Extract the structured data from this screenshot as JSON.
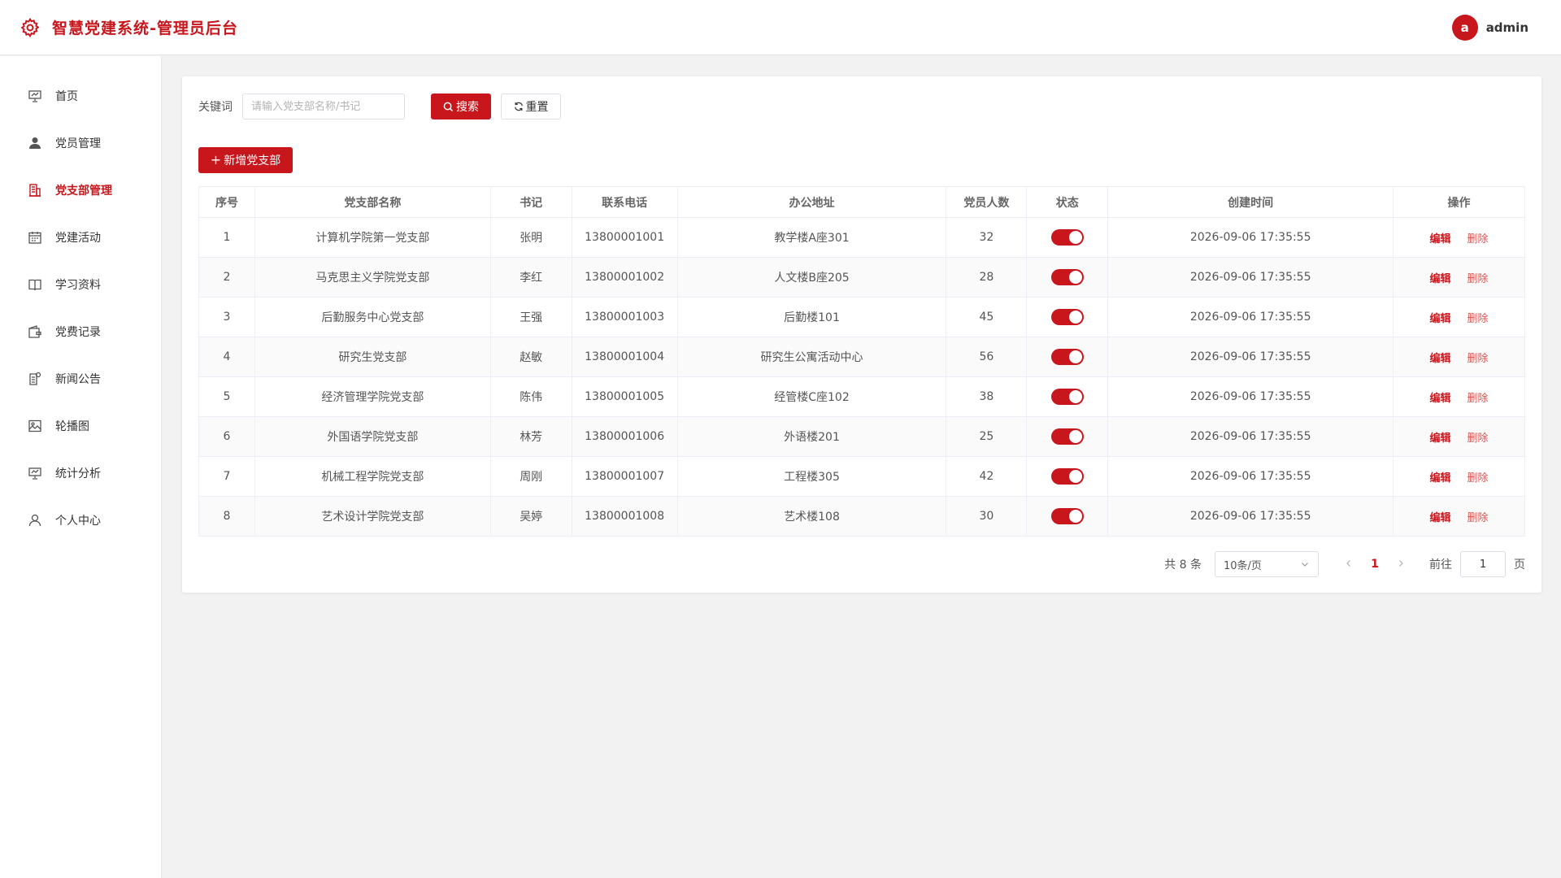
{
  "header": {
    "title": "智慧党建系统-管理员后台",
    "avatar_letter": "a",
    "username": "admin",
    "accent": "#c8161d"
  },
  "sidebar": {
    "items": [
      {
        "label": "首页",
        "icon": "presentation-icon",
        "active": false
      },
      {
        "label": "党员管理",
        "icon": "user-icon",
        "active": false
      },
      {
        "label": "党支部管理",
        "icon": "building-icon",
        "active": true
      },
      {
        "label": "党建活动",
        "icon": "calendar-icon",
        "active": false
      },
      {
        "label": "学习资料",
        "icon": "book-icon",
        "active": false
      },
      {
        "label": "党费记录",
        "icon": "wallet-icon",
        "active": false
      },
      {
        "label": "新闻公告",
        "icon": "news-icon",
        "active": false
      },
      {
        "label": "轮播图",
        "icon": "image-icon",
        "active": false
      },
      {
        "label": "统计分析",
        "icon": "chart-icon",
        "active": false
      },
      {
        "label": "个人中心",
        "icon": "user-outline-icon",
        "active": false
      }
    ]
  },
  "search": {
    "label": "关键词",
    "placeholder": "请输入党支部名称/书记",
    "value": "",
    "search_button": "搜索",
    "reset_button": "重置"
  },
  "toolbar": {
    "add_button": "新增党支部"
  },
  "table": {
    "columns": [
      "序号",
      "党支部名称",
      "书记",
      "联系电话",
      "办公地址",
      "党员人数",
      "状态",
      "创建时间",
      "操作"
    ],
    "rows": [
      {
        "no": "1",
        "name": "计算机学院第一党支部",
        "secretary": "张明",
        "phone": "13800001001",
        "address": "教学楼A座301",
        "members": "32",
        "enabled": true,
        "created": "2026-09-06 17:35:55"
      },
      {
        "no": "2",
        "name": "马克思主义学院党支部",
        "secretary": "李红",
        "phone": "13800001002",
        "address": "人文楼B座205",
        "members": "28",
        "enabled": true,
        "created": "2026-09-06 17:35:55"
      },
      {
        "no": "3",
        "name": "后勤服务中心党支部",
        "secretary": "王强",
        "phone": "13800001003",
        "address": "后勤楼101",
        "members": "45",
        "enabled": true,
        "created": "2026-09-06 17:35:55"
      },
      {
        "no": "4",
        "name": "研究生党支部",
        "secretary": "赵敏",
        "phone": "13800001004",
        "address": "研究生公寓活动中心",
        "members": "56",
        "enabled": true,
        "created": "2026-09-06 17:35:55"
      },
      {
        "no": "5",
        "name": "经济管理学院党支部",
        "secretary": "陈伟",
        "phone": "13800001005",
        "address": "经管楼C座102",
        "members": "38",
        "enabled": true,
        "created": "2026-09-06 17:35:55"
      },
      {
        "no": "6",
        "name": "外国语学院党支部",
        "secretary": "林芳",
        "phone": "13800001006",
        "address": "外语楼201",
        "members": "25",
        "enabled": true,
        "created": "2026-09-06 17:35:55"
      },
      {
        "no": "7",
        "name": "机械工程学院党支部",
        "secretary": "周刚",
        "phone": "13800001007",
        "address": "工程楼305",
        "members": "42",
        "enabled": true,
        "created": "2026-09-06 17:35:55"
      },
      {
        "no": "8",
        "name": "艺术设计学院党支部",
        "secretary": "吴婷",
        "phone": "13800001008",
        "address": "艺术楼108",
        "members": "30",
        "enabled": true,
        "created": "2026-09-06 17:35:55"
      }
    ],
    "edit_label": "编辑",
    "delete_label": "删除"
  },
  "pagination": {
    "total_text": "共 8 条",
    "page_size": "10条/页",
    "current_page": "1",
    "goto_label": "前往",
    "goto_value": "1",
    "page_label": "页"
  }
}
